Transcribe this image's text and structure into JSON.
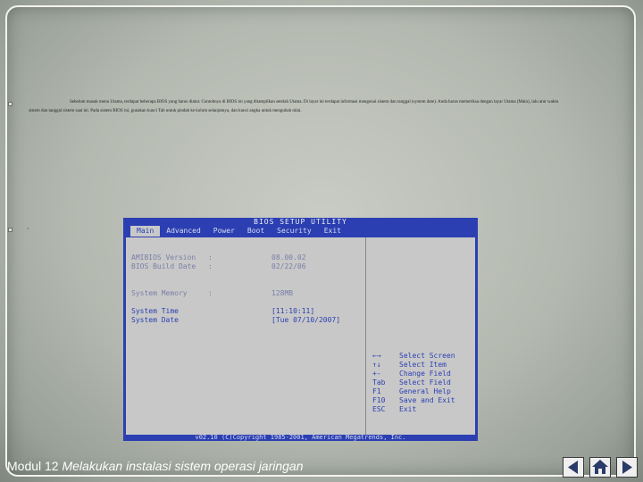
{
  "slide": {
    "paragraph": "Sebelum masuk menu Utama, terdapat beberapa BIOS yang harus diatur. Contohnya di BIOS ini yang ditampilkan setelah Utama. Di layar ini terdapat informasi mengenai sistem dan tanggal (system date). Anda harus memeriksa dengan layar Utama (Main), lalu atur waktu sistem dan tanggal sistem saat ini. Pada sistem BIOS ini, gunakan kunci Tab untuk pindah ke kolom selanjutnya, dan kunci angka untuk mengubah nilai.",
    "bullet_2_text": "`",
    "footer_title_normal": "Modul 12 ",
    "footer_title_italic": "Melakukan instalasi sistem operasi jaringan"
  },
  "bios": {
    "title": "BIOS SETUP UTILITY",
    "menu": [
      "Main",
      "Advanced",
      "Power",
      "Boot",
      "Security",
      "Exit"
    ],
    "active_menu": "Main",
    "rows": [
      {
        "label": "AMIBIOS Version",
        "sep": ":",
        "value": "08.00.02"
      },
      {
        "label": "BIOS Build Date",
        "sep": ":",
        "value": "02/22/06"
      },
      {
        "label": "System Memory",
        "sep": ":",
        "value": "128MB"
      },
      {
        "label": "System Time",
        "sep": "",
        "value": "[11:10:11]"
      },
      {
        "label": "System Date",
        "sep": "",
        "value": "[Tue 07/10/2007]"
      }
    ],
    "keys": [
      {
        "key": "←→",
        "desc": "Select Screen"
      },
      {
        "key": "↑↓",
        "desc": "Select Item"
      },
      {
        "key": "+-",
        "desc": "Change Field"
      },
      {
        "key": "Tab",
        "desc": "Select Field"
      },
      {
        "key": "F1",
        "desc": "General Help"
      },
      {
        "key": "F10",
        "desc": "Save and Exit"
      },
      {
        "key": "ESC",
        "desc": "Exit"
      }
    ],
    "copyright": "v02.10 (C)Copyright 1985-2001, American Megatrends, Inc."
  },
  "nav_icons": [
    "back-icon",
    "home-icon",
    "forward-icon"
  ]
}
